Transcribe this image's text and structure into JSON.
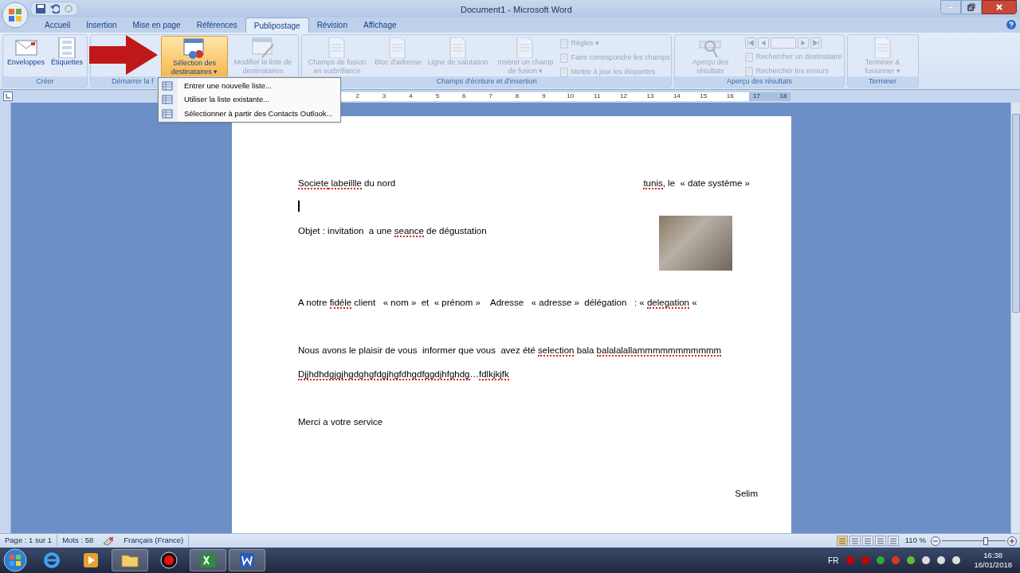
{
  "window": {
    "title": "Document1 - Microsoft Word"
  },
  "tabs": [
    {
      "label": "Accueil",
      "selected": false
    },
    {
      "label": "Insertion",
      "selected": false
    },
    {
      "label": "Mise en page",
      "selected": false
    },
    {
      "label": "Références",
      "selected": false
    },
    {
      "label": "Publipostage",
      "selected": true
    },
    {
      "label": "Révision",
      "selected": false
    },
    {
      "label": "Affichage",
      "selected": false
    }
  ],
  "ribbon": {
    "groups": [
      {
        "label": "Créer",
        "buttons": [
          {
            "kind": "large",
            "label": "Enveloppes",
            "disabled": false,
            "highlighted": false
          },
          {
            "kind": "large",
            "label": "Étiquettes",
            "disabled": false,
            "highlighted": false
          }
        ]
      },
      {
        "label": "Démarrer la f",
        "buttons": [
          {
            "kind": "covered"
          },
          {
            "kind": "large",
            "label": "Sélection des destinataires ▾",
            "disabled": false,
            "highlighted": true
          },
          {
            "kind": "large",
            "label": "Modifier la liste de destinataires",
            "disabled": true,
            "highlighted": false
          }
        ]
      },
      {
        "label": "Champs d'écriture et d'insertion",
        "buttons": [
          {
            "kind": "large",
            "label": "Champs de fusion en surbrillance",
            "disabled": true,
            "highlighted": false
          },
          {
            "kind": "large",
            "label": "Bloc d'adresse",
            "disabled": true,
            "highlighted": false
          },
          {
            "kind": "large",
            "label": "Ligne de salutation",
            "disabled": true,
            "highlighted": false
          },
          {
            "kind": "large",
            "label": "Insérer un champ de fusion ▾",
            "disabled": true,
            "highlighted": false
          },
          {
            "kind": "small",
            "label": "Règles ▾",
            "disabled": true
          },
          {
            "kind": "small",
            "label": "Faire correspondre les champs",
            "disabled": true
          },
          {
            "kind": "small",
            "label": "Mettre à jour les étiquettes",
            "disabled": true
          }
        ]
      },
      {
        "label": "Aperçu des résultats",
        "buttons": [
          {
            "kind": "large",
            "label": "Aperçu des résultats",
            "disabled": true,
            "highlighted": false
          },
          {
            "kind": "nav",
            "disabled": true
          },
          {
            "kind": "small",
            "label": "Rechercher un destinataire",
            "disabled": true
          },
          {
            "kind": "small",
            "label": "Rechercher les erreurs",
            "disabled": true
          }
        ]
      },
      {
        "label": "Terminer",
        "buttons": [
          {
            "kind": "large",
            "label": "Terminer & fusionner ▾",
            "disabled": true,
            "highlighted": false
          }
        ]
      }
    ]
  },
  "dropdown_menu": {
    "items": [
      {
        "label": "Entrer une nouvelle liste..."
      },
      {
        "label": "Utiliser la liste existante..."
      },
      {
        "label": "Sélectionner à partir des Contacts Outlook..."
      }
    ]
  },
  "ruler": {
    "marks": [
      "2",
      "3",
      "4",
      "5",
      "6",
      "7",
      "8",
      "9",
      "10",
      "11",
      "12",
      "13",
      "14",
      "15",
      "16",
      "17",
      "18"
    ]
  },
  "document": {
    "paragraphs": [
      {
        "kind": "split",
        "left": [
          {
            "text": "Societe",
            "misspelled": true
          },
          {
            "text": " labeillle",
            "misspelled": true
          },
          {
            "text": " du nord",
            "misspelled": false
          }
        ],
        "right": [
          {
            "text": "tunis",
            "misspelled": true
          },
          {
            "text": ", le  « date système »",
            "misspelled": false
          }
        ]
      },
      {
        "kind": "cursor"
      },
      {
        "kind": "text",
        "right_aligned": false,
        "segments": [
          {
            "text": "Objet : invitation  a une ",
            "misspelled": false
          },
          {
            "text": "seance",
            "misspelled": true
          },
          {
            "text": " de dégustation",
            "misspelled": false
          }
        ]
      },
      {
        "kind": "empty"
      },
      {
        "kind": "empty"
      },
      {
        "kind": "text",
        "right_aligned": false,
        "segments": [
          {
            "text": "A notre ",
            "misspelled": false
          },
          {
            "text": "fidéle",
            "misspelled": true
          },
          {
            "text": " client   « nom »  et  « prénom »    Adresse   « adresse »  délégation   : « ",
            "misspelled": false
          },
          {
            "text": "delegation",
            "misspelled": true
          },
          {
            "text": " «",
            "misspelled": false
          }
        ]
      },
      {
        "kind": "empty"
      },
      {
        "kind": "text",
        "right_aligned": false,
        "segments": [
          {
            "text": "Nous avons le plaisir de vous  informer que vous  avez été ",
            "misspelled": false
          },
          {
            "text": "selection",
            "misspelled": true
          },
          {
            "text": " bala ",
            "misspelled": false
          },
          {
            "text": "balalalallammmmmmmmmmm",
            "misspelled": true
          }
        ]
      },
      {
        "kind": "text",
        "right_aligned": false,
        "segments": [
          {
            "text": "Djjhdhdgjgjhgdghgfdgjhgfdhgdfggdjhfghdg",
            "misspelled": true
          },
          {
            "text": "…",
            "misspelled": false
          },
          {
            "text": "fdlkjkjfk",
            "misspelled": true
          }
        ]
      },
      {
        "kind": "empty"
      },
      {
        "kind": "text",
        "right_aligned": false,
        "segments": [
          {
            "text": "Merci a votre service",
            "misspelled": false
          }
        ]
      },
      {
        "kind": "empty"
      },
      {
        "kind": "empty"
      },
      {
        "kind": "text",
        "right_aligned": true,
        "segments": [
          {
            "text": "Selim",
            "misspelled": false
          }
        ]
      }
    ]
  },
  "status_bar": {
    "page": "Page : 1 sur 1",
    "words": "Mots : 58",
    "language": "Français (France)",
    "zoom": "110 %",
    "zoom_slider": {
      "level": 0.69
    }
  },
  "taskbar": {
    "apps": [
      {
        "running": false
      },
      {
        "running": false
      },
      {
        "running": true
      },
      {
        "running": false
      },
      {
        "running": true
      },
      {
        "running": true
      }
    ],
    "language": "FR",
    "time": "16:38",
    "date": "16/01/2018"
  }
}
